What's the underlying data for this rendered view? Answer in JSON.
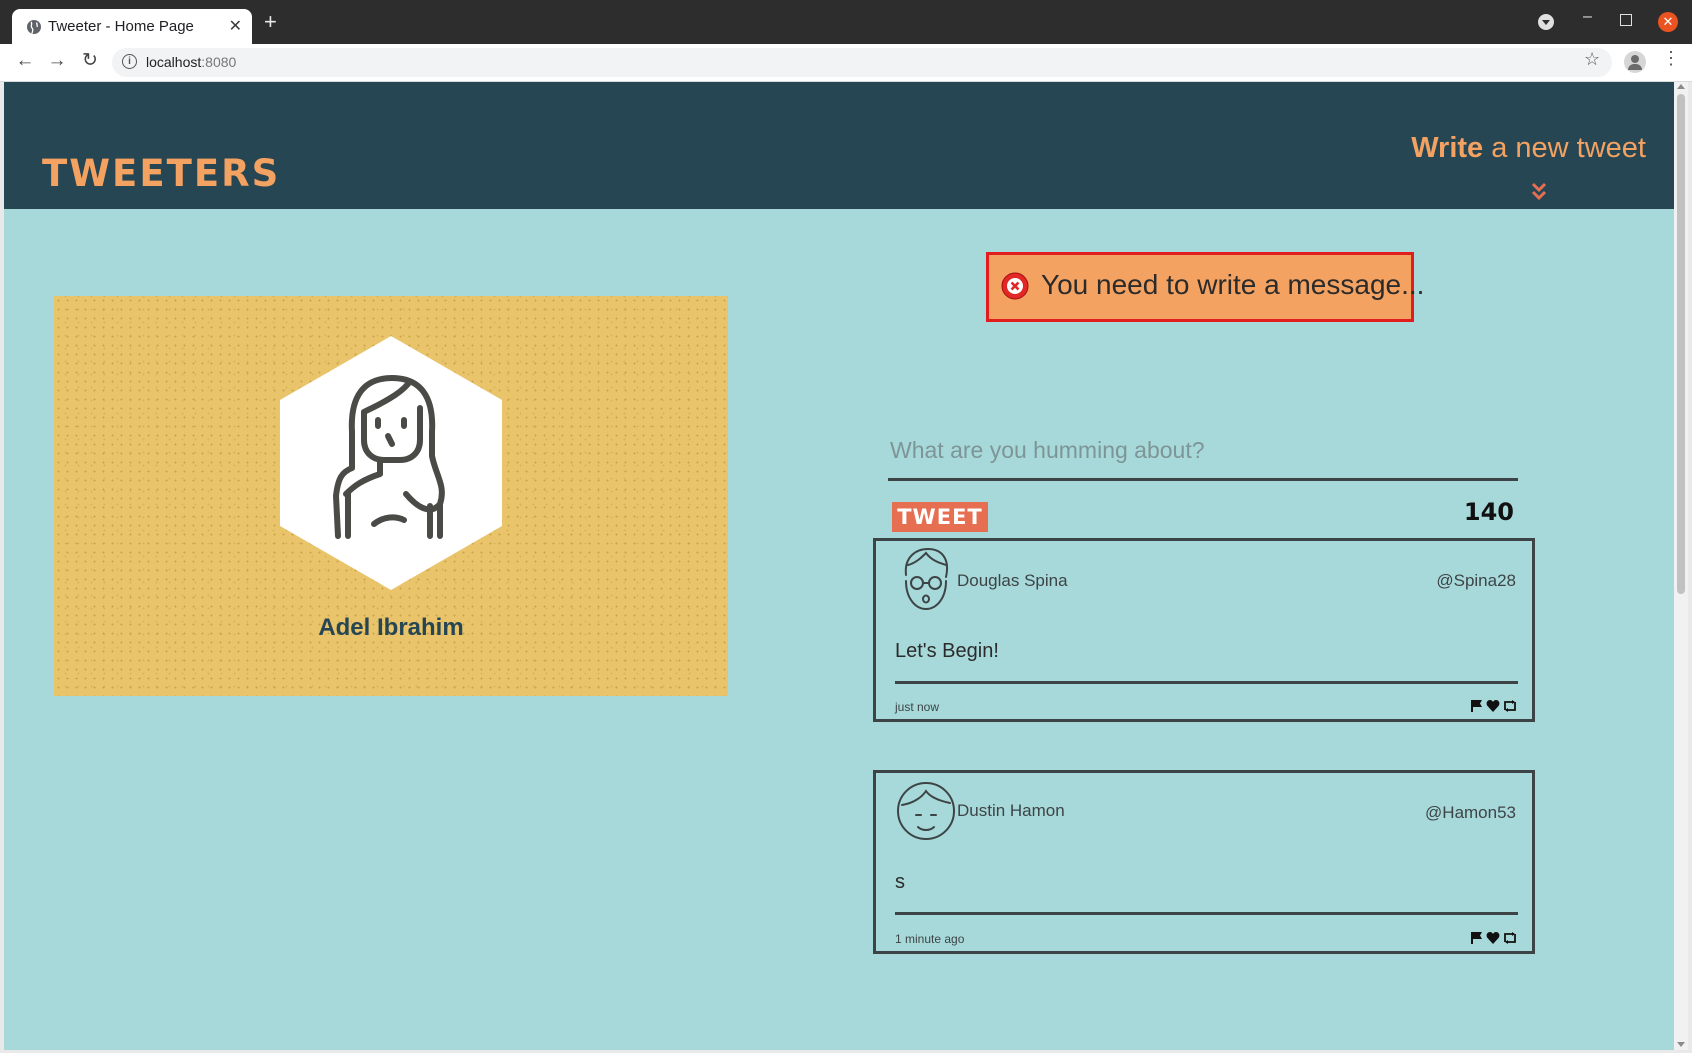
{
  "browser": {
    "tab_title": "Tweeter - Home Page",
    "new_tab_symbol": "+",
    "url_host": "localhost",
    "url_port": ":8080",
    "icons": [
      "globe-icon",
      "close-icon",
      "back-arrow-icon",
      "forward-arrow-icon",
      "reload-icon",
      "info-icon",
      "star-icon",
      "profile-icon",
      "kebab-menu-icon"
    ]
  },
  "header": {
    "logo": "TWEETERS",
    "write_bold": "Write",
    "write_rest": " a new tweet",
    "toggle_icon": "double-chevron-down-icon"
  },
  "profile": {
    "name": "Adel Ibrahim",
    "avatar_icon": "woman-avatar-icon"
  },
  "error": {
    "icon": "error-x-icon",
    "message": "You need to write a message..."
  },
  "compose": {
    "placeholder": "What are you humming about?",
    "value": "",
    "button_label": "TWEET",
    "counter": "140"
  },
  "tweets": [
    {
      "name": "Douglas Spina",
      "handle": "@Spina28",
      "text": "Let's Begin!",
      "time": "just now",
      "avatar_icon": "glasses-man-avatar-icon"
    },
    {
      "name": "Dustin Hamon",
      "handle": "@Hamon53",
      "text": "s",
      "time": "1 minute ago",
      "avatar_icon": "man-avatar-icon"
    }
  ],
  "colors": {
    "header_bg": "#264653",
    "page_bg": "#a8d9da",
    "accent_orange": "#f4a261",
    "card_yellow": "#e9c46a",
    "tweet_button": "#e76f51",
    "error_border": "#e11d1d"
  }
}
